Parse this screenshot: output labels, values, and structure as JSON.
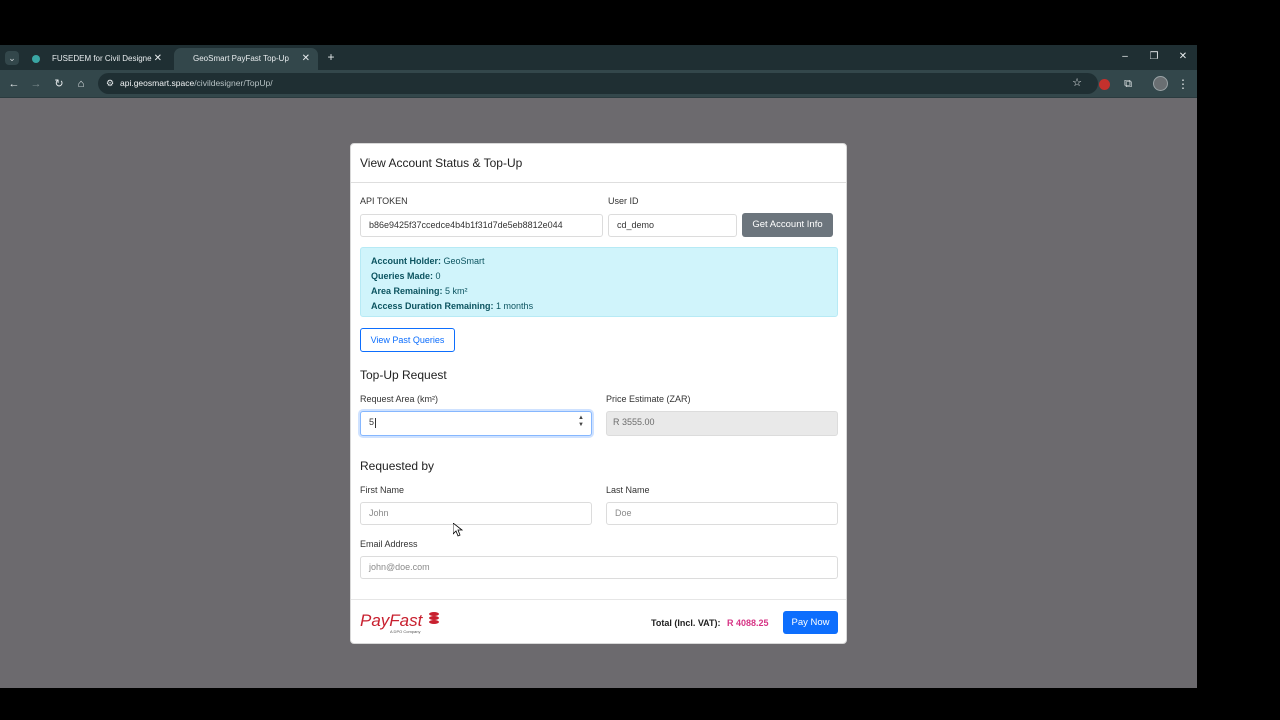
{
  "browser": {
    "tabs": [
      {
        "title": "FUSEDEM for Civil Designer - G"
      },
      {
        "title": "GeoSmart PayFast Top-Up"
      }
    ],
    "url_host": "api.geosmart.space",
    "url_path": "/civildesigner/TopUp/"
  },
  "card": {
    "title": "View Account Status & Top-Up",
    "api_token_label": "API TOKEN",
    "api_token_value": "b86e9425f37ccedce4b4b1f31d7de5eb8812e044",
    "user_id_label": "User ID",
    "user_id_value": "cd_demo",
    "get_info_button": "Get Account Info",
    "account": [
      {
        "key": "Account Holder:",
        "value": "GeoSmart"
      },
      {
        "key": "Queries Made:",
        "value": "0"
      },
      {
        "key": "Area Remaining:",
        "value": "5 km²"
      },
      {
        "key": "Access Duration Remaining:",
        "value": "1 months"
      }
    ],
    "view_past_button": "View Past Queries",
    "topup_title": "Top-Up Request",
    "area_label": "Request Area (km²)",
    "area_value": "5",
    "price_label": "Price Estimate (ZAR)",
    "price_value": "R 3555.00",
    "requested_by_title": "Requested by",
    "first_name_label": "First Name",
    "first_name_placeholder": "John",
    "last_name_label": "Last Name",
    "last_name_placeholder": "Doe",
    "email_label": "Email Address",
    "email_placeholder": "john@doe.com",
    "total_label": "Total (Incl. VAT):",
    "total_value": "R 4088.25",
    "pay_button": "Pay Now",
    "logo_text": "PayFast",
    "logo_sub": "A DPO Company"
  },
  "colors": {
    "primary": "#0d6efd",
    "secondary": "#6c757d",
    "info_bg": "#d0f4fb",
    "total": "#d63384",
    "payfast_red": "#c8202f"
  }
}
